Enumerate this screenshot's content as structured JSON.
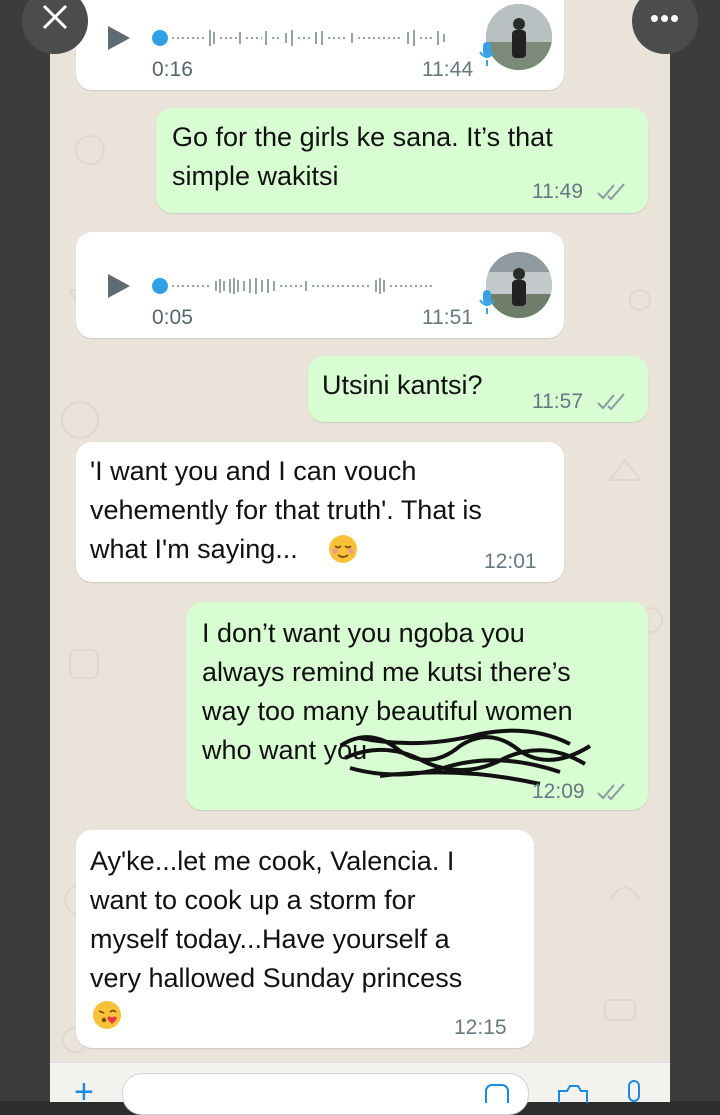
{
  "messages": [
    {
      "type": "voice",
      "direction": "in",
      "duration": "0:16",
      "time": "11:44"
    },
    {
      "type": "text",
      "direction": "out",
      "text": "Go for the girls ke sana. It’s that\nsimple wakitsi",
      "time": "11:49",
      "status": "read"
    },
    {
      "type": "voice",
      "direction": "in",
      "duration": "0:05",
      "time": "11:51"
    },
    {
      "type": "text",
      "direction": "out",
      "text": "Utsini kantsi?",
      "time": "11:57",
      "status": "read"
    },
    {
      "type": "text",
      "direction": "in",
      "text": "'I want you and I can vouch\nvehemently for that truth'. That is\nwhat I'm saying...",
      "emoji": "relieved-face",
      "time": "12:01"
    },
    {
      "type": "text",
      "direction": "out",
      "text": "I don’t want you ngoba you\nalways remind me kutsi there’s\nway too many beautiful women\nwho want you",
      "redacted": true,
      "time": "12:09",
      "status": "read"
    },
    {
      "type": "text",
      "direction": "in",
      "text": "Ay'ke...let me cook, Valencia. I\nwant to cook up a storm for\nmyself today...Have yourself a\nvery hallowed Sunday princess",
      "emoji": "face-blowing-kiss",
      "time": "12:15"
    }
  ],
  "header": {
    "close_icon": "close-icon",
    "more_icon": "more-icon",
    "more_label": "•••"
  },
  "composer": {
    "plus_label": "+",
    "icons": [
      "plus-icon",
      "sticker-icon",
      "camera-icon",
      "mic-icon"
    ]
  },
  "colors": {
    "incoming": "#ffffff",
    "outgoing": "#d9fdd3",
    "chat_bg": "#e9e3da",
    "voice_dot": "#2fa0e6"
  }
}
